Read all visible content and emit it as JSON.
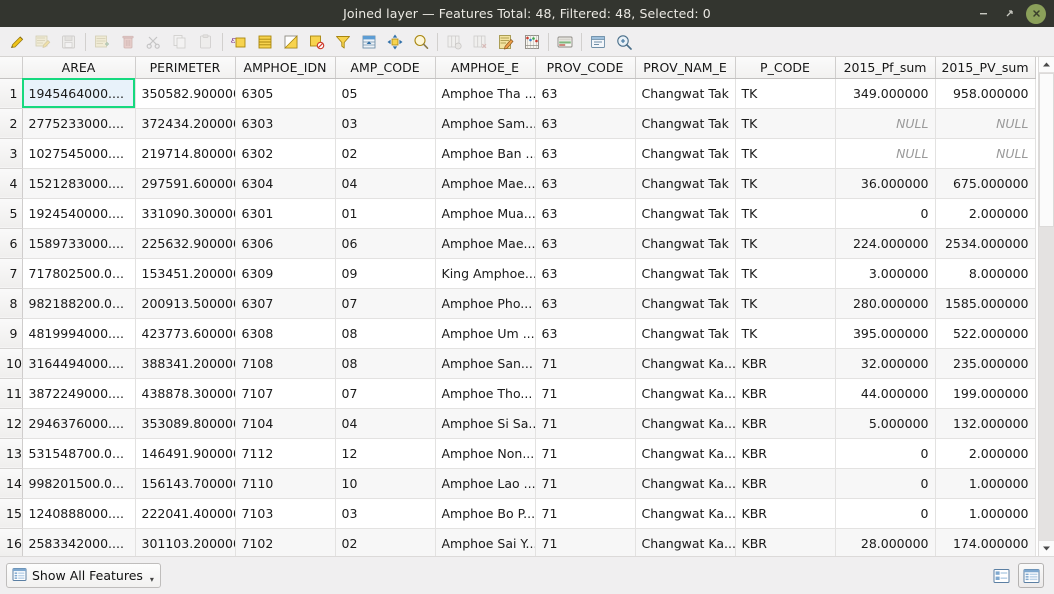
{
  "window": {
    "title": "Joined layer — Features Total: 48, Filtered: 48, Selected: 0",
    "minimize_label": "–",
    "maximize_label": "⤡",
    "close_label": "✕"
  },
  "toolbar": {
    "buttons": [
      {
        "name": "toggle-editing",
        "tip": "Toggle editing mode",
        "enabled": true
      },
      {
        "name": "save-edits",
        "tip": "Save edits",
        "enabled": false
      },
      {
        "name": "reload-table",
        "tip": "Reload the table",
        "enabled": false
      },
      {
        "name": "add-feature",
        "tip": "Add feature",
        "enabled": false
      },
      {
        "name": "delete-selected",
        "tip": "Delete selected features",
        "enabled": false
      },
      {
        "name": "cut-features",
        "tip": "Cut selected features to clipboard",
        "enabled": false
      },
      {
        "name": "copy-features",
        "tip": "Copy selected features to clipboard",
        "enabled": false
      },
      {
        "name": "paste-features",
        "tip": "Paste features from clipboard",
        "enabled": false
      },
      {
        "name": "select-by-expression",
        "tip": "Select features using an expression",
        "enabled": true
      },
      {
        "name": "select-all",
        "tip": "Select all features",
        "enabled": true
      },
      {
        "name": "invert-selection",
        "tip": "Invert selection",
        "enabled": true
      },
      {
        "name": "deselect-all",
        "tip": "Deselect all features",
        "enabled": true
      },
      {
        "name": "filter-select",
        "tip": "Filter / select features using form",
        "enabled": true
      },
      {
        "name": "move-selection-to-top",
        "tip": "Move selection to top",
        "enabled": true
      },
      {
        "name": "pan-map-to-selected",
        "tip": "Pan map to selected rows",
        "enabled": true
      },
      {
        "name": "zoom-map-to-selected",
        "tip": "Zoom map to selected rows",
        "enabled": true
      },
      {
        "name": "new-field",
        "tip": "New field",
        "enabled": false
      },
      {
        "name": "delete-field",
        "tip": "Delete field",
        "enabled": false
      },
      {
        "name": "field-calculator",
        "tip": "Open field calculator",
        "enabled": true
      },
      {
        "name": "conditional-formatting",
        "tip": "Conditional formatting",
        "enabled": true
      },
      {
        "name": "organize-columns",
        "tip": "Organize columns",
        "enabled": true
      },
      {
        "name": "actions",
        "tip": "Actions",
        "enabled": true
      },
      {
        "name": "form-view-search",
        "tip": "Dock attribute table / search",
        "enabled": true
      }
    ]
  },
  "table": {
    "columns": [
      {
        "key": "AREA",
        "label": "AREA",
        "align": "left"
      },
      {
        "key": "PERIMETER",
        "label": "PERIMETER",
        "align": "right"
      },
      {
        "key": "AMPHOE_IDN",
        "label": "AMPHOE_IDN",
        "align": "left"
      },
      {
        "key": "AMP_CODE",
        "label": "AMP_CODE",
        "align": "left"
      },
      {
        "key": "AMPHOE_E",
        "label": "AMPHOE_E",
        "align": "left"
      },
      {
        "key": "PROV_CODE",
        "label": "PROV_CODE",
        "align": "left"
      },
      {
        "key": "PROV_NAM_E",
        "label": "PROV_NAM_E",
        "align": "left"
      },
      {
        "key": "P_CODE",
        "label": "P_CODE",
        "align": "left"
      },
      {
        "key": "2015_Pf_sum",
        "label": "2015_Pf_sum",
        "align": "right"
      },
      {
        "key": "2015_PV_sum",
        "label": "2015_PV_sum",
        "align": "right"
      }
    ],
    "selected_cell": {
      "row": 1,
      "column": "AREA"
    },
    "rows": [
      {
        "n": "1",
        "AREA": "1945464000....",
        "PERIMETER": "350582.900000",
        "AMPHOE_IDN": "6305",
        "AMP_CODE": "05",
        "AMPHOE_E": "Amphoe Tha ...",
        "PROV_CODE": "63",
        "PROV_NAM_E": "Changwat Tak",
        "P_CODE": "TK",
        "2015_Pf_sum": "349.000000",
        "2015_PV_sum": "958.000000"
      },
      {
        "n": "2",
        "AREA": "2775233000....",
        "PERIMETER": "372434.200000",
        "AMPHOE_IDN": "6303",
        "AMP_CODE": "03",
        "AMPHOE_E": "Amphoe Sam...",
        "PROV_CODE": "63",
        "PROV_NAM_E": "Changwat Tak",
        "P_CODE": "TK",
        "2015_Pf_sum": "NULL",
        "2015_PV_sum": "NULL"
      },
      {
        "n": "3",
        "AREA": "1027545000....",
        "PERIMETER": "219714.800000",
        "AMPHOE_IDN": "6302",
        "AMP_CODE": "02",
        "AMPHOE_E": "Amphoe Ban ...",
        "PROV_CODE": "63",
        "PROV_NAM_E": "Changwat Tak",
        "P_CODE": "TK",
        "2015_Pf_sum": "NULL",
        "2015_PV_sum": "NULL"
      },
      {
        "n": "4",
        "AREA": "1521283000....",
        "PERIMETER": "297591.600000",
        "AMPHOE_IDN": "6304",
        "AMP_CODE": "04",
        "AMPHOE_E": "Amphoe Mae...",
        "PROV_CODE": "63",
        "PROV_NAM_E": "Changwat Tak",
        "P_CODE": "TK",
        "2015_Pf_sum": "36.000000",
        "2015_PV_sum": "675.000000"
      },
      {
        "n": "5",
        "AREA": "1924540000....",
        "PERIMETER": "331090.300000",
        "AMPHOE_IDN": "6301",
        "AMP_CODE": "01",
        "AMPHOE_E": "Amphoe Mua...",
        "PROV_CODE": "63",
        "PROV_NAM_E": "Changwat Tak",
        "P_CODE": "TK",
        "2015_Pf_sum": "0",
        "2015_PV_sum": "2.000000"
      },
      {
        "n": "6",
        "AREA": "1589733000....",
        "PERIMETER": "225632.900000",
        "AMPHOE_IDN": "6306",
        "AMP_CODE": "06",
        "AMPHOE_E": "Amphoe Mae...",
        "PROV_CODE": "63",
        "PROV_NAM_E": "Changwat Tak",
        "P_CODE": "TK",
        "2015_Pf_sum": "224.000000",
        "2015_PV_sum": "2534.000000"
      },
      {
        "n": "7",
        "AREA": "717802500.0...",
        "PERIMETER": "153451.200000",
        "AMPHOE_IDN": "6309",
        "AMP_CODE": "09",
        "AMPHOE_E": "King Amphoe...",
        "PROV_CODE": "63",
        "PROV_NAM_E": "Changwat Tak",
        "P_CODE": "TK",
        "2015_Pf_sum": "3.000000",
        "2015_PV_sum": "8.000000"
      },
      {
        "n": "8",
        "AREA": "982188200.0...",
        "PERIMETER": "200913.500000",
        "AMPHOE_IDN": "6307",
        "AMP_CODE": "07",
        "AMPHOE_E": "Amphoe Pho...",
        "PROV_CODE": "63",
        "PROV_NAM_E": "Changwat Tak",
        "P_CODE": "TK",
        "2015_Pf_sum": "280.000000",
        "2015_PV_sum": "1585.000000"
      },
      {
        "n": "9",
        "AREA": "4819994000....",
        "PERIMETER": "423773.600000",
        "AMPHOE_IDN": "6308",
        "AMP_CODE": "08",
        "AMPHOE_E": "Amphoe Um ...",
        "PROV_CODE": "63",
        "PROV_NAM_E": "Changwat Tak",
        "P_CODE": "TK",
        "2015_Pf_sum": "395.000000",
        "2015_PV_sum": "522.000000"
      },
      {
        "n": "10",
        "AREA": "3164494000....",
        "PERIMETER": "388341.200000",
        "AMPHOE_IDN": "7108",
        "AMP_CODE": "08",
        "AMPHOE_E": "Amphoe San...",
        "PROV_CODE": "71",
        "PROV_NAM_E": "Changwat Ka...",
        "P_CODE": "KBR",
        "2015_Pf_sum": "32.000000",
        "2015_PV_sum": "235.000000"
      },
      {
        "n": "11",
        "AREA": "3872249000....",
        "PERIMETER": "438878.300000",
        "AMPHOE_IDN": "7107",
        "AMP_CODE": "07",
        "AMPHOE_E": "Amphoe Tho...",
        "PROV_CODE": "71",
        "PROV_NAM_E": "Changwat Ka...",
        "P_CODE": "KBR",
        "2015_Pf_sum": "44.000000",
        "2015_PV_sum": "199.000000"
      },
      {
        "n": "12",
        "AREA": "2946376000....",
        "PERIMETER": "353089.800000",
        "AMPHOE_IDN": "7104",
        "AMP_CODE": "04",
        "AMPHOE_E": "Amphoe Si Sa...",
        "PROV_CODE": "71",
        "PROV_NAM_E": "Changwat Ka...",
        "P_CODE": "KBR",
        "2015_Pf_sum": "5.000000",
        "2015_PV_sum": "132.000000"
      },
      {
        "n": "13",
        "AREA": "531548700.0...",
        "PERIMETER": "146491.900000",
        "AMPHOE_IDN": "7112",
        "AMP_CODE": "12",
        "AMPHOE_E": "Amphoe Non...",
        "PROV_CODE": "71",
        "PROV_NAM_E": "Changwat Ka...",
        "P_CODE": "KBR",
        "2015_Pf_sum": "0",
        "2015_PV_sum": "2.000000"
      },
      {
        "n": "14",
        "AREA": "998201500.0...",
        "PERIMETER": "156143.700000",
        "AMPHOE_IDN": "7110",
        "AMP_CODE": "10",
        "AMPHOE_E": "Amphoe Lao ...",
        "PROV_CODE": "71",
        "PROV_NAM_E": "Changwat Ka...",
        "P_CODE": "KBR",
        "2015_Pf_sum": "0",
        "2015_PV_sum": "1.000000"
      },
      {
        "n": "15",
        "AREA": "1240888000....",
        "PERIMETER": "222041.400000",
        "AMPHOE_IDN": "7103",
        "AMP_CODE": "03",
        "AMPHOE_E": "Amphoe Bo P...",
        "PROV_CODE": "71",
        "PROV_NAM_E": "Changwat Ka...",
        "P_CODE": "KBR",
        "2015_Pf_sum": "0",
        "2015_PV_sum": "1.000000"
      },
      {
        "n": "16",
        "AREA": "2583342000....",
        "PERIMETER": "301103.200000",
        "AMPHOE_IDN": "7102",
        "AMP_CODE": "02",
        "AMPHOE_E": "Amphoe Sai Y...",
        "PROV_CODE": "71",
        "PROV_NAM_E": "Changwat Ka...",
        "P_CODE": "KBR",
        "2015_Pf_sum": "28.000000",
        "2015_PV_sum": "174.000000"
      },
      {
        "n": "",
        "AREA": "",
        "PERIMETER": "",
        "AMPHOE_IDN": "",
        "AMP_CODE": "",
        "AMPHOE_E": "",
        "PROV_CODE": "",
        "PROV_NAM_E": "",
        "P_CODE": "",
        "2015_Pf_sum": "",
        "2015_PV_sum": ""
      }
    ]
  },
  "statusbar": {
    "filter_label": "Show All Features",
    "filter_caret": "▾",
    "view_form_name": "form-view",
    "view_table_name": "table-view"
  },
  "colors": {
    "titlebar_bg": "#33352f",
    "close_button": "#8ba05a",
    "selection_outline": "#16d97f",
    "selection_fill": "#e8f2fa",
    "null_text": "#9a9a9a",
    "chrome_bg": "#f0eff0"
  }
}
